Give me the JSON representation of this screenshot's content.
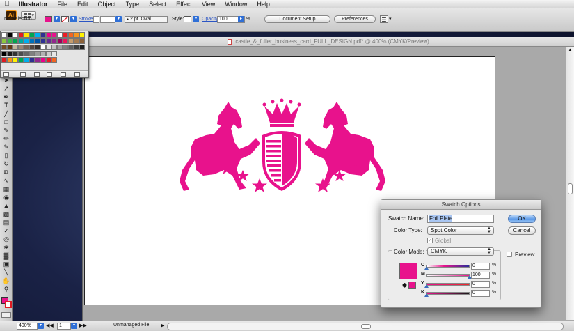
{
  "menubar": {
    "app_name": "Illustrator",
    "items": [
      "File",
      "Edit",
      "Object",
      "Type",
      "Select",
      "Effect",
      "View",
      "Window",
      "Help"
    ]
  },
  "app": {
    "logo": "Ai"
  },
  "controlbar": {
    "selection": "No Selection",
    "stroke_label": "Stroke",
    "brush": "2 pt. Oval",
    "style_label": "Style:",
    "opacity_label": "Opacity:",
    "opacity_value": "100",
    "percent": "%",
    "document_setup": "Document Setup",
    "preferences": "Preferences",
    "fill_color": "#e8128c"
  },
  "document": {
    "title": "castle_&_fuller_business_card_FULL_DESIGN.pdf* @ 400% (CMYK/Preview)",
    "artwork_color": "#e8128c"
  },
  "statusbar": {
    "zoom": "400%",
    "page": "1",
    "status": "Unmanaged File"
  },
  "tools": [
    "selection-tool",
    "direct-selection-tool",
    "pen-tool",
    "type-tool",
    "line-tool",
    "rectangle-tool",
    "paintbrush-tool",
    "pencil-tool",
    "blob-brush-tool",
    "eraser-tool",
    "rotate-tool",
    "scale-tool",
    "width-tool",
    "free-transform-tool",
    "shape-builder-tool",
    "perspective-grid-tool",
    "mesh-tool",
    "gradient-tool",
    "eyedropper-tool",
    "blend-tool",
    "symbol-sprayer-tool",
    "column-graph-tool",
    "artboard-tool",
    "slice-tool",
    "hand-tool",
    "zoom-tool"
  ],
  "swatch_panel": {
    "row1": [
      "#ffffff",
      "#000000",
      "#ffffff",
      "#e01b23",
      "#ffe400",
      "#00a651",
      "#00aeef",
      "#2e3192",
      "#ec008c",
      "#e8128c",
      "#ffffff",
      "#ed1c24",
      "#f26522",
      "#f7941d",
      "#fff200"
    ],
    "row2": [
      "#8dc63f",
      "#39b54a",
      "#00a651",
      "#00a99d",
      "#00aeef",
      "#0072bc",
      "#0054a6",
      "#2e3192",
      "#662d91",
      "#92278f",
      "#9e005d",
      "#ed145b",
      "#c69c6d",
      "#a67c52",
      "#8c6239"
    ],
    "row3": [
      "#754c24",
      "#603913",
      "#c2b59b",
      "#998675",
      "#736357",
      "#534741",
      "#362f2d",
      "#ffffff",
      "#e0e0e0",
      "#c0c0c0",
      "#a0a0a0",
      "#808080",
      "#606060",
      "#404040",
      "#202020"
    ],
    "row4": [
      "#000000",
      "#1a1a1a",
      "#333333",
      "#4d4d4d",
      "#666666",
      "#808080",
      "#999999",
      "#b3b3b3",
      "#cccccc",
      "#e6e6e6"
    ],
    "row5": [
      "#e01b23",
      "#f7941d",
      "#fff200",
      "#00a651",
      "#00aeef",
      "#2e3192",
      "#92278f",
      "#ec008c",
      "#ed1c24",
      "#f26522"
    ]
  },
  "dialog": {
    "title": "Swatch Options",
    "swatch_name_label": "Swatch Name:",
    "swatch_name_value": "Foil Plate",
    "color_type_label": "Color Type:",
    "color_type_value": "Spot Color",
    "global_label": "Global",
    "color_mode_label": "Color Mode:",
    "color_mode_value": "CMYK",
    "ok_label": "OK",
    "cancel_label": "Cancel",
    "preview_label": "Preview",
    "swatch_color": "#e8128c",
    "channels": [
      {
        "name": "C",
        "value": "0",
        "fraction": 0.0
      },
      {
        "name": "M",
        "value": "100",
        "fraction": 1.0
      },
      {
        "name": "Y",
        "value": "0",
        "fraction": 0.0
      },
      {
        "name": "K",
        "value": "0",
        "fraction": 0.0
      }
    ],
    "percent": "%"
  }
}
